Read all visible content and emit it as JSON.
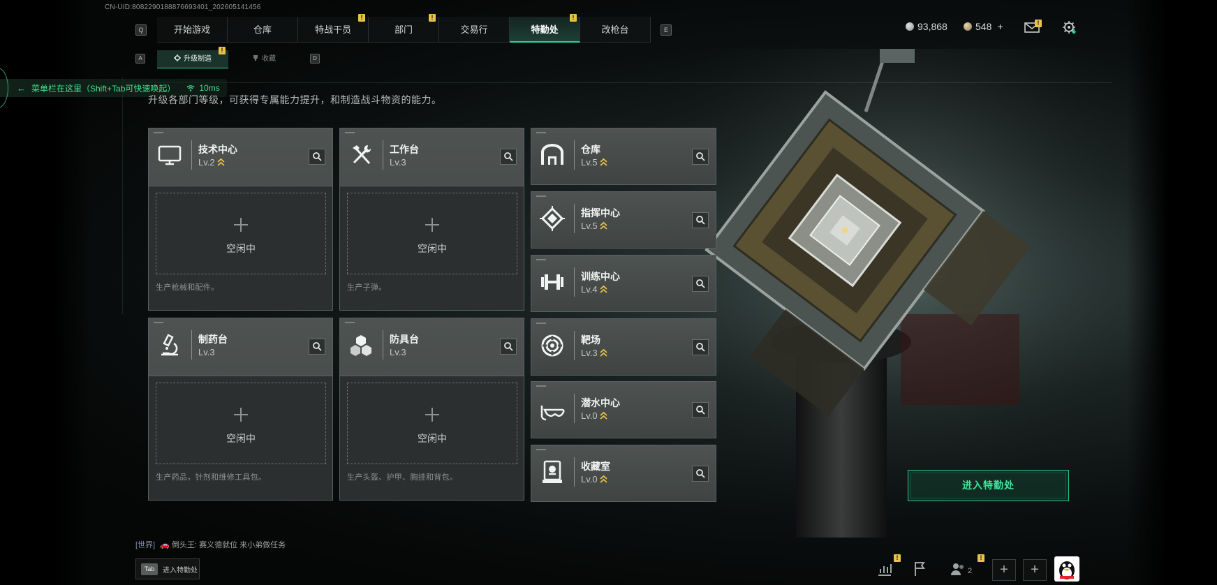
{
  "uid": "CN-UID:8082290188876693401_202605141456",
  "nav": {
    "left_key": "Q",
    "right_key": "E",
    "tabs": [
      {
        "label": "开始游戏",
        "badge": ""
      },
      {
        "label": "仓库",
        "badge": ""
      },
      {
        "label": "特战干员",
        "badge": "!"
      },
      {
        "label": "部门",
        "badge": "!"
      },
      {
        "label": "交易行",
        "badge": ""
      },
      {
        "label": "特勤处",
        "badge": "!"
      },
      {
        "label": "改枪台",
        "badge": ""
      }
    ],
    "active_index": 5
  },
  "subnav": {
    "left_key": "A",
    "right_key": "D",
    "tabs": [
      {
        "label": "升级制造",
        "badge": "!"
      },
      {
        "label": "收藏",
        "badge": ""
      }
    ],
    "active_index": 0
  },
  "resources": {
    "coins": "93,868",
    "tickets": "548",
    "tickets_add": "+",
    "mail_badge": "!"
  },
  "overlay": {
    "text": "菜单栏在这里（Shift+Tab可快速唤起）",
    "ping": "10ms"
  },
  "description": "升级各部门等级，可获得专属能力提升，和制造战斗物资的能力。",
  "idle_label": "空闲中",
  "production_cards": [
    {
      "name": "技术中心",
      "level": "Lv.2",
      "upgradable": true,
      "icon": "monitor-icon",
      "desc": "生产枪械和配件。"
    },
    {
      "name": "工作台",
      "level": "Lv.3",
      "upgradable": false,
      "icon": "hammer-wrench-icon",
      "desc": "生产子弹。"
    },
    {
      "name": "制药台",
      "level": "Lv.3",
      "upgradable": false,
      "icon": "microscope-icon",
      "desc": "生产药品，针剂和维修工具包。"
    },
    {
      "name": "防具台",
      "level": "Lv.3",
      "upgradable": false,
      "icon": "cubes-icon",
      "desc": "生产头盔、护甲、胸挂和背包。"
    }
  ],
  "facility_cards": [
    {
      "name": "仓库",
      "level": "Lv.5",
      "upgradable": true,
      "icon": "warehouse-icon"
    },
    {
      "name": "指挥中心",
      "level": "Lv.5",
      "upgradable": true,
      "icon": "command-icon"
    },
    {
      "name": "训练中心",
      "level": "Lv.4",
      "upgradable": true,
      "icon": "dumbbell-icon"
    },
    {
      "name": "靶场",
      "level": "Lv.3",
      "upgradable": true,
      "icon": "target-icon"
    },
    {
      "name": "潜水中心",
      "level": "Lv.0",
      "upgradable": true,
      "icon": "diving-mask-icon"
    },
    {
      "name": "收藏室",
      "level": "Lv.0",
      "upgradable": true,
      "icon": "collection-icon"
    }
  ],
  "enter_button": "进入特勤处",
  "chat": {
    "channel": "[世界]",
    "sender": "倒头王:",
    "message": "赛义德就位 来小弟做任务"
  },
  "tab_hint": {
    "key": "Tab",
    "label": "进入特勤处"
  },
  "bottom": {
    "friends_count": "2",
    "badge": "!"
  },
  "colors": {
    "accent": "#27d59a",
    "badge": "#e9c24a",
    "card": "#4b504f"
  }
}
